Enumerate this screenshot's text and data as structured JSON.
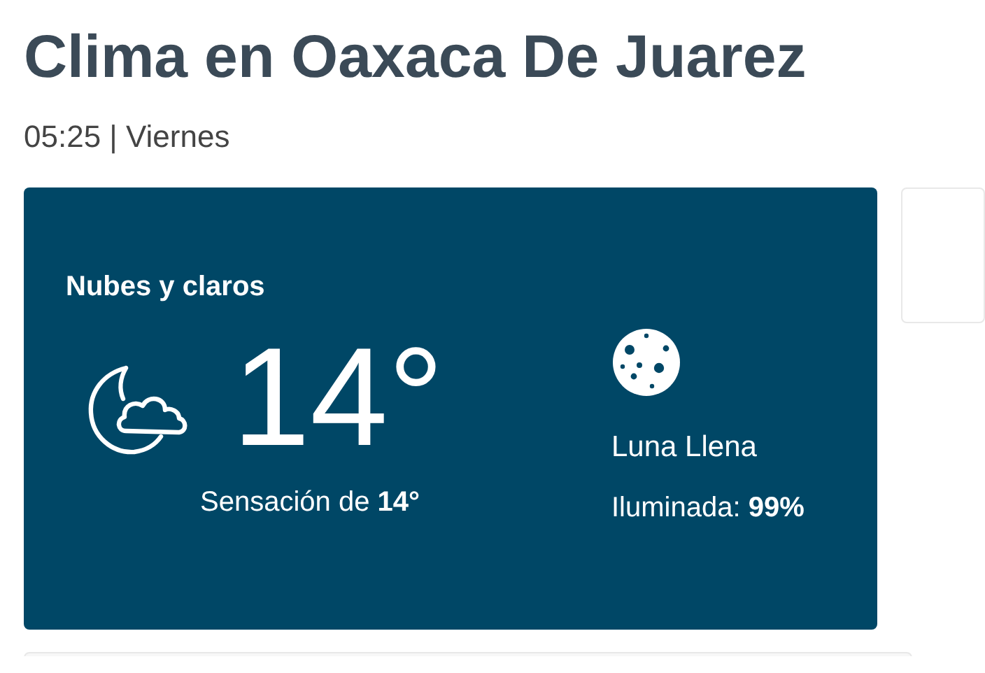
{
  "title": "Clima en Oaxaca De Juarez",
  "subtitle": "05:25 | Viernes",
  "weather": {
    "condition": "Nubes y claros",
    "temperature": "14°",
    "feels_like": "Sensación de **14°**"
  },
  "moon": {
    "phase": "Luna Llena",
    "illumination": "Iluminada: **99%**"
  }
}
